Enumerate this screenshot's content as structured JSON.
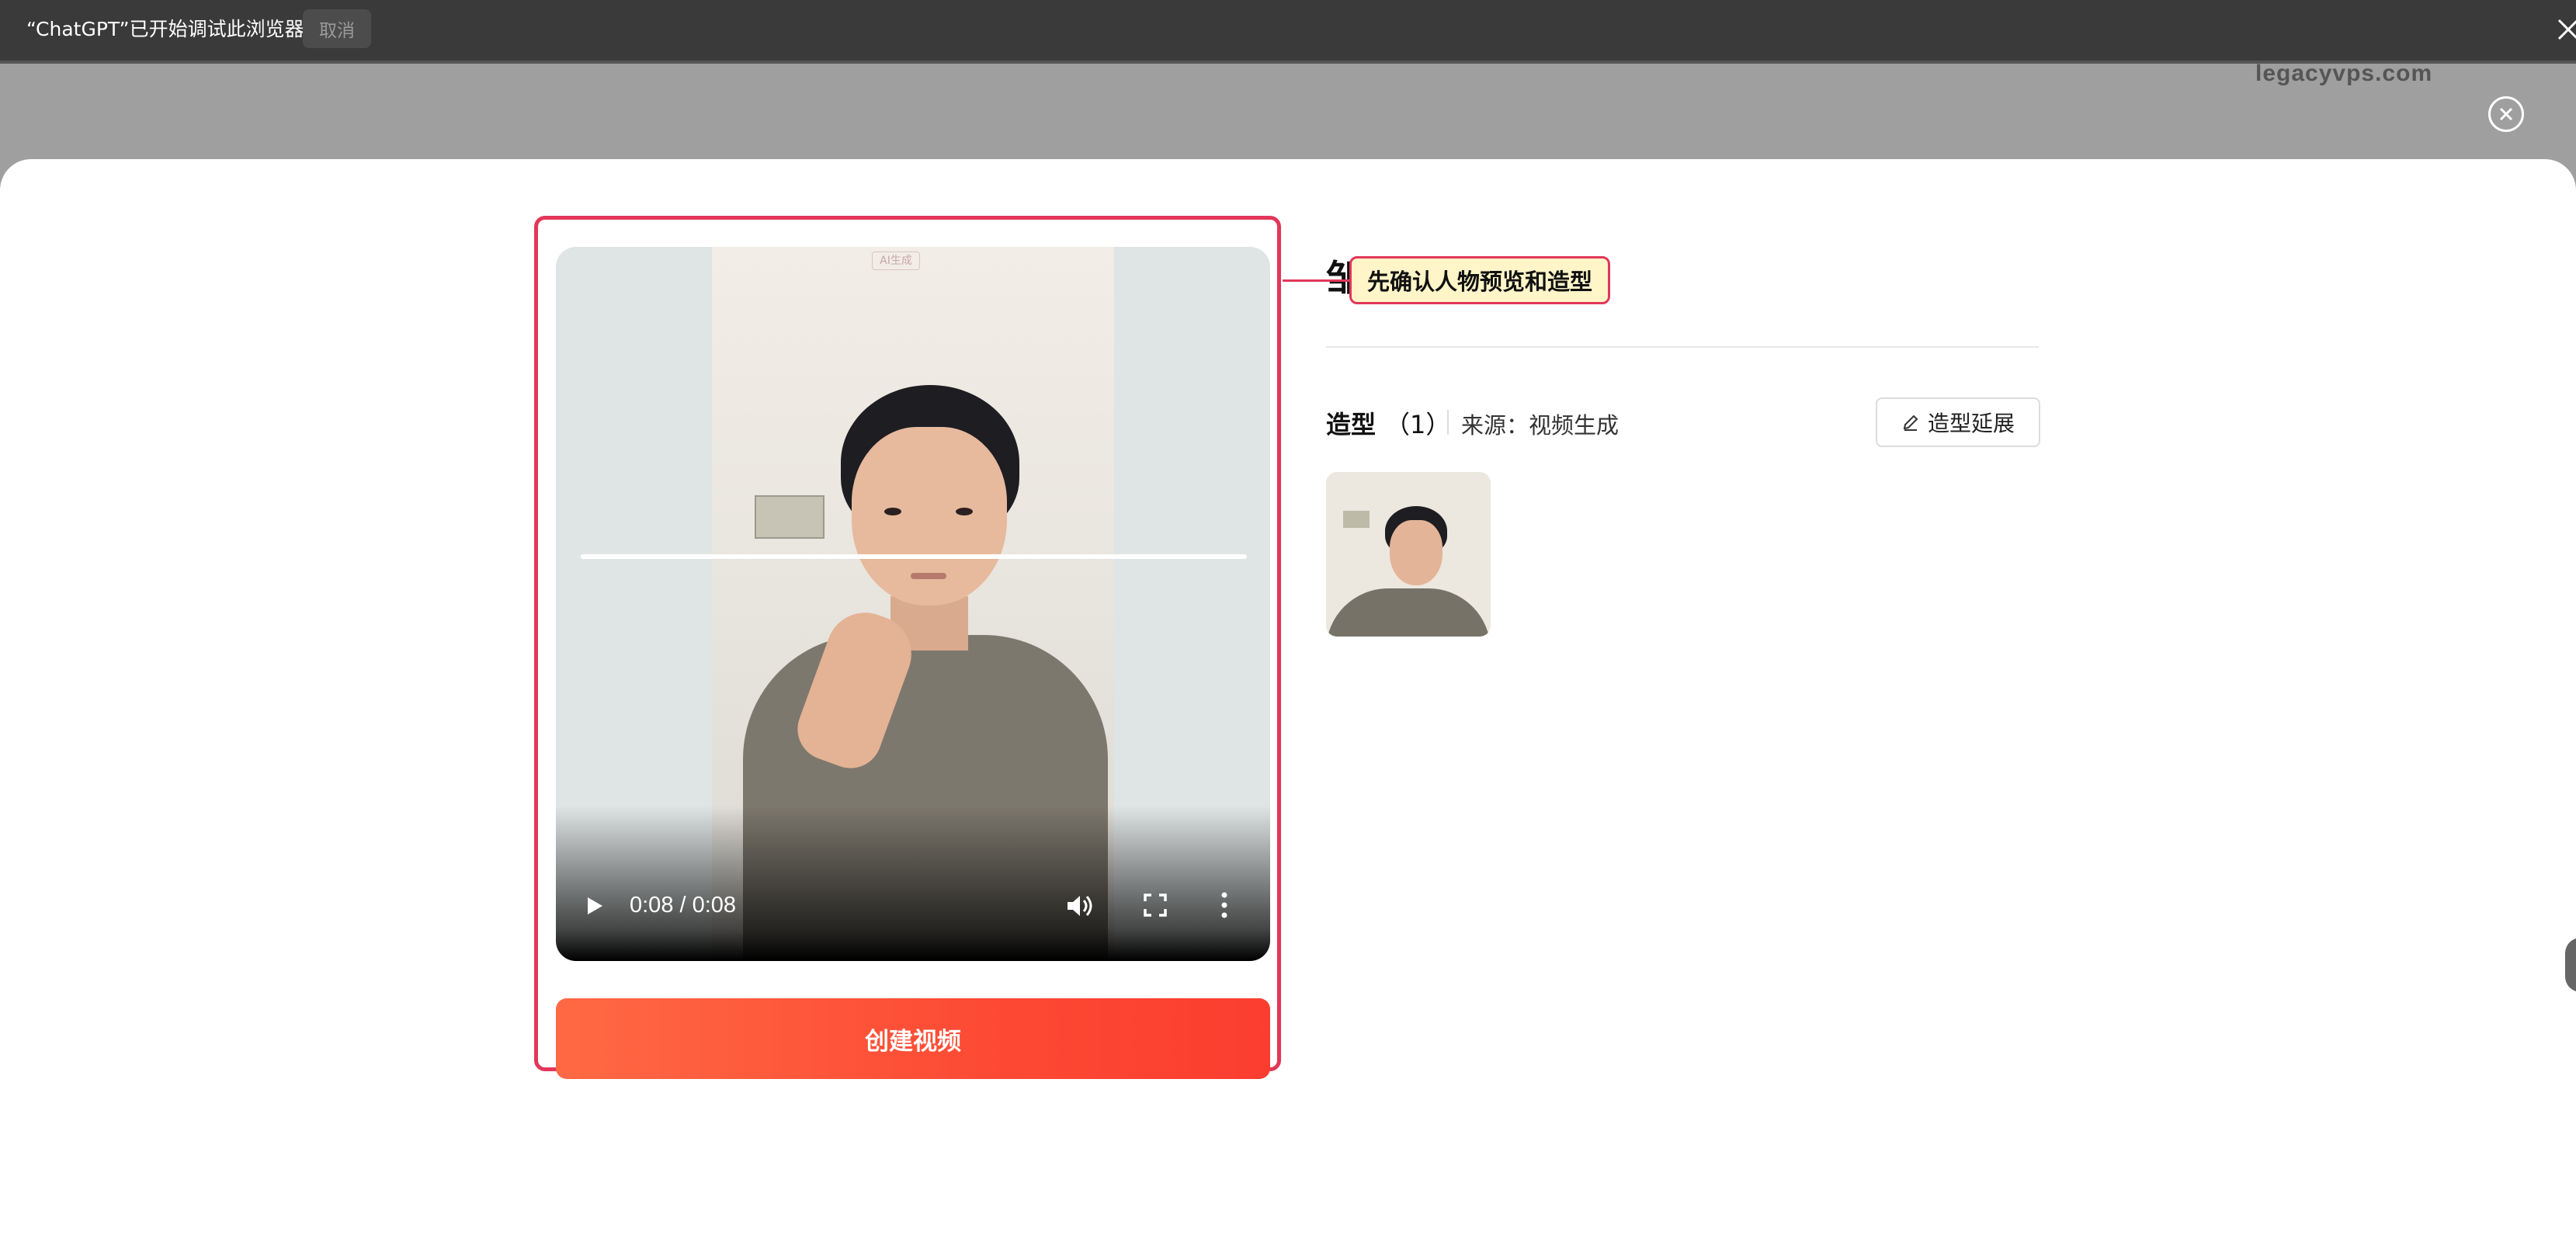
{
  "debug_bar": {
    "message": "“ChatGPT”已开始调试此浏览器",
    "cancel_label": "取消"
  },
  "watermark": "legacyvps.com",
  "video": {
    "watermark_text": "AI生成",
    "time_display": "0:08 / 0:08",
    "progress": 1.0
  },
  "create_button_label": "创建视频",
  "profile": {
    "name_visible": "邹",
    "callout": "先确认人物预览和造型"
  },
  "styles_section": {
    "title": "造型",
    "count": "（1）",
    "source": "来源：视频生成",
    "extend_button_label": "造型延展"
  },
  "colors": {
    "accent": "#fb3d2f",
    "highlight_border": "#e2375a",
    "callout_bg": "#fff5c8"
  }
}
